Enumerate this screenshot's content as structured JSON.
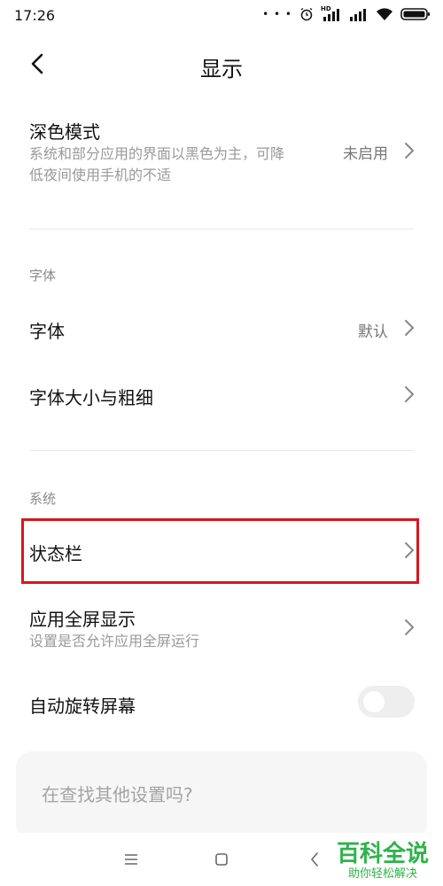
{
  "status_bar": {
    "time": "17:26",
    "network_badge": "HD",
    "dots": "• • •"
  },
  "header": {
    "title": "显示"
  },
  "dark_mode": {
    "title": "深色模式",
    "subtitle_line1": "系统和部分应用的界面以黑色为主，可降",
    "subtitle_line2": "低夜间使用手机的不适",
    "value": "未启用"
  },
  "font_section": {
    "label": "字体",
    "font_title": "字体",
    "font_value": "默认",
    "font_size_title": "字体大小与粗细"
  },
  "system_section": {
    "label": "系统",
    "status_bar_title": "状态栏",
    "fullscreen_title": "应用全屏显示",
    "fullscreen_subtitle": "设置是否允许应用全屏运行",
    "auto_rotate_title": "自动旋转屏幕",
    "auto_rotate_enabled": false
  },
  "search_card": {
    "text": "在查找其他设置吗?"
  },
  "watermark": {
    "main": "百科全说",
    "sub": "助你轻松解决"
  },
  "colors": {
    "highlight": "#d8161e",
    "watermark": "#2fb24a"
  }
}
